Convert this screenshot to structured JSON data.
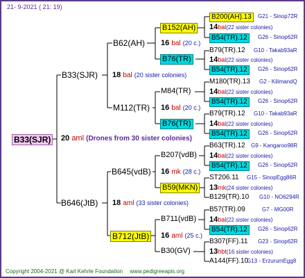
{
  "header": {
    "date": "21-  9-2021",
    "time": "( 21: 19)"
  },
  "root": {
    "name": "B33(SJR)",
    "num": "20",
    "breeder": "aml",
    "note": "(Drones from 30 sister colonies)"
  },
  "gen2": [
    {
      "name": "B33(SJR)",
      "num": "18",
      "breeder": "bal",
      "note": "(20 sister colonies)"
    },
    {
      "name": "B646(JtB)",
      "num": "18",
      "breeder": "aml",
      "note": "(33 sister colonies)"
    }
  ],
  "gen3": [
    {
      "name": "B62(AH)",
      "num": "16",
      "breeder": "bal",
      "note": "(20 c.)"
    },
    {
      "name": "M112(TR)",
      "num": "16",
      "breeder": "bal",
      "note": "(20 c.)"
    },
    {
      "name": "B645(vdB)",
      "num": "16",
      "breeder": "mk",
      "note": "(28 c.)"
    },
    {
      "name": "B712(JtB)",
      "num": "16",
      "breeder": "aml",
      "note": "(25 c.)"
    }
  ],
  "gen4": [
    {
      "name": "B152(AH)",
      "num": "14",
      "breeder": "bal",
      "note": "(22 sister colonies)"
    },
    {
      "name": "B76(TR)",
      "num": "14",
      "breeder": "bal",
      "note": "(22 sister colonies)"
    },
    {
      "name": "M84(TR)",
      "num": "14",
      "breeder": "bal",
      "note": "(22 sister colonies)"
    },
    {
      "name": "B76(TR)",
      "num": "14",
      "breeder": "bal",
      "note": "(22 sister colonies)"
    },
    {
      "name": "B207(vdB)",
      "num": "14",
      "breeder": "bal",
      "note": "(22 sister colonies)"
    },
    {
      "name": "B59(MKN)",
      "num": "13",
      "breeder": "mk",
      "note": "(24 sister colonies)"
    },
    {
      "name": "B711(vdB)",
      "num": "14",
      "breeder": "bal",
      "note": "(22 sister colonies)"
    },
    {
      "name": "B30(GV)",
      "num": "13",
      "breeder": "hbt",
      "note": "(16 sister colonies)"
    }
  ],
  "gen5": [
    {
      "name": "B200(AH).13",
      "origin": "G21 - Sinop72R"
    },
    {
      "name": "B54(TR).12",
      "origin": "G26 - Sinop62R"
    },
    {
      "name": "B79(TR).12",
      "origin": "G10 - Takab93aR"
    },
    {
      "name": "B54(TR).12",
      "origin": "G26 - Sinop62R"
    },
    {
      "name": "M180(TR).13",
      "origin": "G2 - KilimandQ"
    },
    {
      "name": "B54(TR).12",
      "origin": "G26 - Sinop62R"
    },
    {
      "name": "B79(TR).12",
      "origin": "G10 - Takab93aR"
    },
    {
      "name": "B54(TR).12",
      "origin": "G26 - Sinop62R"
    },
    {
      "name": "B63(TR).12",
      "origin": "G9 - Kangaroo98R"
    },
    {
      "name": "B54(TR).12",
      "origin": "G26 - Sinop62R"
    },
    {
      "name": "ST206.11",
      "origin": "G15 - SinopEgg86R"
    },
    {
      "name": "B129(TR).10",
      "origin": "G10 - NO6294R"
    },
    {
      "name": "B57(TR).09",
      "origin": "G7 - MG00R"
    },
    {
      "name": "B54(TR).12",
      "origin": "G26 - Sinop62R"
    },
    {
      "name": "B307(FF).11",
      "origin": "G23 - Sinop62R"
    },
    {
      "name": "A144(FF).10",
      "origin": "G13 - ErzurumEgg8"
    }
  ],
  "footer": {
    "copyright": "Copyright 2004-2021 @ Karl Kehrle Foundation",
    "website": "www.pedigreeapis.org"
  },
  "colors": {
    "border": "#5a3a8a",
    "highlight_yellow": "#ffff00",
    "highlight_cyan": "#00d8e0",
    "highlight_pink": "#f0c8f0",
    "breeder_red": "#c00000",
    "note_blue": "#1a1aa8",
    "footer_green": "#1a6a1a"
  }
}
